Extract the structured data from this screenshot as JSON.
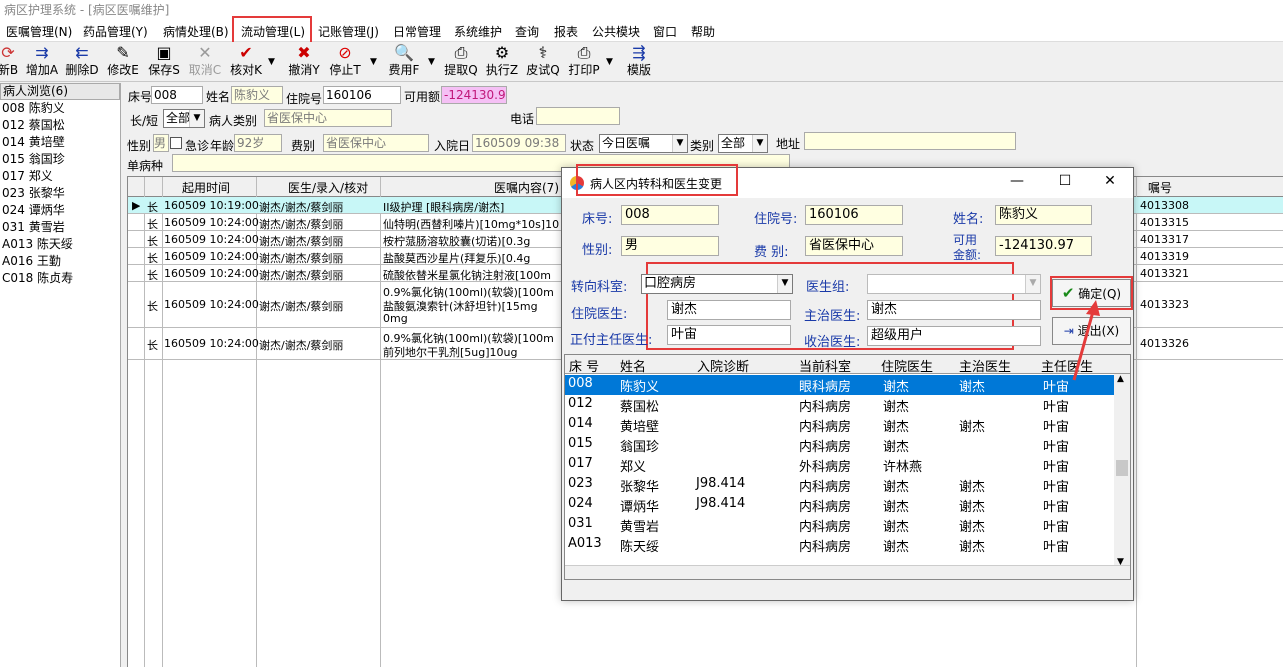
{
  "app": {
    "title": "病区护理系统 - [病区医嘱维护]"
  },
  "menu": [
    "医嘱管理(N)",
    "药品管理(Y)",
    "病情处理(B)",
    "流动管理(L)",
    "记账管理(J)",
    "日常管理",
    "系统维护",
    "查询",
    "报表",
    "公共模块",
    "窗口",
    "帮助"
  ],
  "toolbar": [
    {
      "label": "新B",
      "icon": "refresh-icon"
    },
    {
      "label": "增加A",
      "icon": "add-icon"
    },
    {
      "label": "删除D",
      "icon": "delete-icon"
    },
    {
      "label": "修改E",
      "icon": "edit-icon"
    },
    {
      "label": "保存S",
      "icon": "save-icon"
    },
    {
      "label": "取消C",
      "icon": "cancel-icon"
    },
    {
      "label": "核对K",
      "icon": "check-icon"
    },
    {
      "label": "撤消Y",
      "icon": "undo-icon"
    },
    {
      "label": "停止T",
      "icon": "stop-icon"
    },
    {
      "label": "费用F",
      "icon": "fee-icon"
    },
    {
      "label": "提取Q",
      "icon": "extract-icon"
    },
    {
      "label": "执行Z",
      "icon": "execute-icon"
    },
    {
      "label": "皮试Q",
      "icon": "skin-test-icon"
    },
    {
      "label": "打印P",
      "icon": "print-icon"
    },
    {
      "label": "模版",
      "icon": "template-icon"
    }
  ],
  "patient_browser": {
    "title": "病人浏览(6)",
    "items": [
      "008 陈豹义",
      "012 蔡国松",
      "014 黄培壁",
      "015 翁国珍",
      "017 郑义",
      "023 张黎华",
      "024 谭炳华",
      "031 黄雪岩",
      "A013 陈天绥",
      "A016 王勤",
      "C018 陈贞寿"
    ]
  },
  "patient_form": {
    "bed_label": "床号",
    "bed": "008",
    "name_label": "姓名",
    "name": "陈豹义",
    "hosp_no_label": "住院号",
    "hosp_no": "160106",
    "balance_label": "可用额",
    "balance": "-124130.9",
    "long_short_label": "长/短",
    "long_short": "全部",
    "patient_type_label": "病人类别",
    "patient_type": "省医保中心",
    "phone_label": "电话",
    "phone": "",
    "gender_label": "性别",
    "gender": "男",
    "emergency_label": "急诊",
    "age_label": "年龄",
    "age": "92岁",
    "fee_type_label": "费别",
    "fee_type": "省医保中心",
    "admit_date_label": "入院日",
    "admit_date": "160509 09:38",
    "status_label": "状态",
    "status": "今日医嘱",
    "category_label": "类别",
    "category": "全部",
    "address_label": "地址",
    "address": "",
    "single_disease_label": "单病种",
    "single_disease": ""
  },
  "orders_grid": {
    "headers": [
      "起用时间",
      "医生/录入/核对",
      "医嘱内容(7)",
      "嘱号"
    ],
    "rows": [
      {
        "type": "长",
        "time": "160509 10:19:00",
        "doctor": "谢杰/谢杰/蔡剑丽",
        "content": "II级护理  [眼科病房/谢杰]",
        "no": "4013308"
      },
      {
        "type": "长",
        "time": "160509 10:24:00",
        "doctor": "谢杰/谢杰/蔡剑丽",
        "content": "仙特明(西替利嗪片)[10mg*10s]10",
        "no": "4013315"
      },
      {
        "type": "长",
        "time": "160509 10:24:00",
        "doctor": "谢杰/谢杰/蔡剑丽",
        "content": "桉柠蒎肠溶软胶囊(切诺)[0.3g",
        "no": "4013317"
      },
      {
        "type": "长",
        "time": "160509 10:24:00",
        "doctor": "谢杰/谢杰/蔡剑丽",
        "content": "盐酸莫西沙星片(拜复乐)[0.4g",
        "no": "4013319"
      },
      {
        "type": "长",
        "time": "160509 10:24:00",
        "doctor": "谢杰/谢杰/蔡剑丽",
        "content": "硫酸依替米星氯化钠注射液[100m",
        "no": "4013321"
      },
      {
        "type": "长",
        "time": "160509 10:24:00",
        "doctor": "谢杰/谢杰/蔡剑丽",
        "content_lines": [
          "0.9%氯化钠(100ml)(软袋)[100m",
          "盐酸氨溴索针(沐舒坦针)[15mg",
          "0mg"
        ],
        "no": "4013323"
      },
      {
        "type": "长",
        "time": "160509 10:24:00",
        "doctor": "谢杰/谢杰/蔡剑丽",
        "content_lines": [
          "0.9%氯化钠(100ml)(软袋)[100m",
          "前列地尔干乳剂[5ug]10ug"
        ],
        "no": "4013326"
      }
    ]
  },
  "dialog": {
    "title": "病人区内转科和医生变更",
    "bed_label": "床号:",
    "bed": "008",
    "hosp_no_label": "住院号:",
    "hosp_no": "160106",
    "name_label": "姓名:",
    "name": "陈豹义",
    "gender_label": "性别:",
    "gender": "男",
    "fee_label": "费  别:",
    "fee": "省医保中心",
    "avail_label_1": "可用",
    "avail_label_2": "金额:",
    "avail": "-124130.97",
    "transfer_dept_label": "转向科室:",
    "transfer_dept": "口腔病房",
    "doctor_group_label": "医生组:",
    "doctor_group": "",
    "resident_label": "住院医生:",
    "resident": "谢杰",
    "attending_label": "主治医生:",
    "attending": "谢杰",
    "chief_label": "正付主任医生:",
    "chief": "叶宙",
    "admitting_label": "收治医生:",
    "admitting": "超级用户",
    "ok_label": "确定(Q)",
    "exit_label": "退出(X)",
    "list_headers": [
      "床 号",
      "姓名",
      "入院诊断",
      "当前科室",
      "住院医生",
      "主治医生",
      "主任医生"
    ],
    "list_rows": [
      [
        "008",
        "陈豹义",
        "",
        "眼科病房",
        "谢杰",
        "谢杰",
        "叶宙"
      ],
      [
        "012",
        "蔡国松",
        "",
        "内科病房",
        "谢杰",
        "",
        "叶宙"
      ],
      [
        "014",
        "黄培壁",
        "",
        "内科病房",
        "谢杰",
        "谢杰",
        "叶宙"
      ],
      [
        "015",
        "翁国珍",
        "",
        "内科病房",
        "谢杰",
        "",
        "叶宙"
      ],
      [
        "017",
        "郑义",
        "",
        "外科病房",
        "许林燕",
        "",
        "叶宙"
      ],
      [
        "023",
        "张黎华",
        "J98.414",
        "内科病房",
        "谢杰",
        "谢杰",
        "叶宙"
      ],
      [
        "024",
        "谭炳华",
        "J98.414",
        "内科病房",
        "谢杰",
        "谢杰",
        "叶宙"
      ],
      [
        "031",
        "黄雪岩",
        "",
        "内科病房",
        "谢杰",
        "谢杰",
        "叶宙"
      ],
      [
        "A013",
        "陈天绥",
        "",
        "内科病房",
        "谢杰",
        "谢杰",
        "叶宙"
      ]
    ]
  },
  "colors": {
    "highlight_box": "#e43a3a",
    "selection": "#0078d7",
    "balance_bg": "#f5c0f5"
  }
}
